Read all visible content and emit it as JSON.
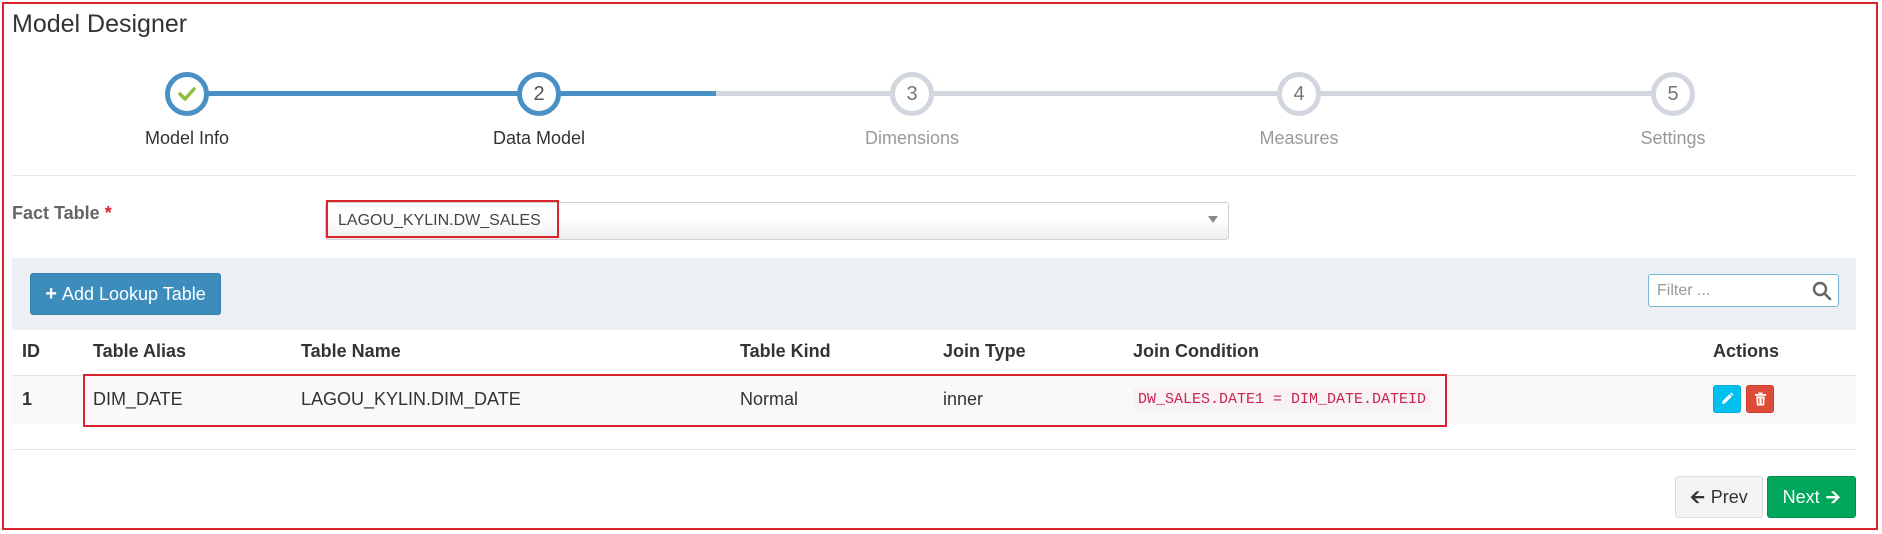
{
  "page": {
    "title": "Model Designer"
  },
  "wizard": {
    "steps": [
      {
        "number": "1",
        "label": "Model Info",
        "state": "done"
      },
      {
        "number": "2",
        "label": "Data Model",
        "state": "active"
      },
      {
        "number": "3",
        "label": "Dimensions",
        "state": "pending"
      },
      {
        "number": "4",
        "label": "Measures",
        "state": "pending"
      },
      {
        "number": "5",
        "label": "Settings",
        "state": "pending"
      }
    ],
    "check_icon": "check-icon",
    "accent_color": "#4a90c4"
  },
  "fact_table": {
    "label": "Fact Table",
    "required_mark": "*",
    "selected": "LAGOU_KYLIN.DW_SALES"
  },
  "toolbar": {
    "add_lookup_label": "Add Lookup Table",
    "filter_placeholder": "Filter ..."
  },
  "table": {
    "columns": [
      "ID",
      "Table Alias",
      "Table Name",
      "Table Kind",
      "Join Type",
      "Join Condition",
      "Actions"
    ],
    "rows": [
      {
        "id": "1",
        "alias": "DIM_DATE",
        "name": "LAGOU_KYLIN.DIM_DATE",
        "kind": "Normal",
        "join_type": "inner",
        "join_condition": "DW_SALES.DATE1 = DIM_DATE.DATEID"
      }
    ]
  },
  "footer": {
    "prev_label": "Prev",
    "next_label": "Next"
  },
  "colors": {
    "highlight": "#d9232d",
    "primary": "#3c8dbc",
    "success": "#00a65a",
    "info": "#00c0ef",
    "danger": "#dd4b39"
  }
}
